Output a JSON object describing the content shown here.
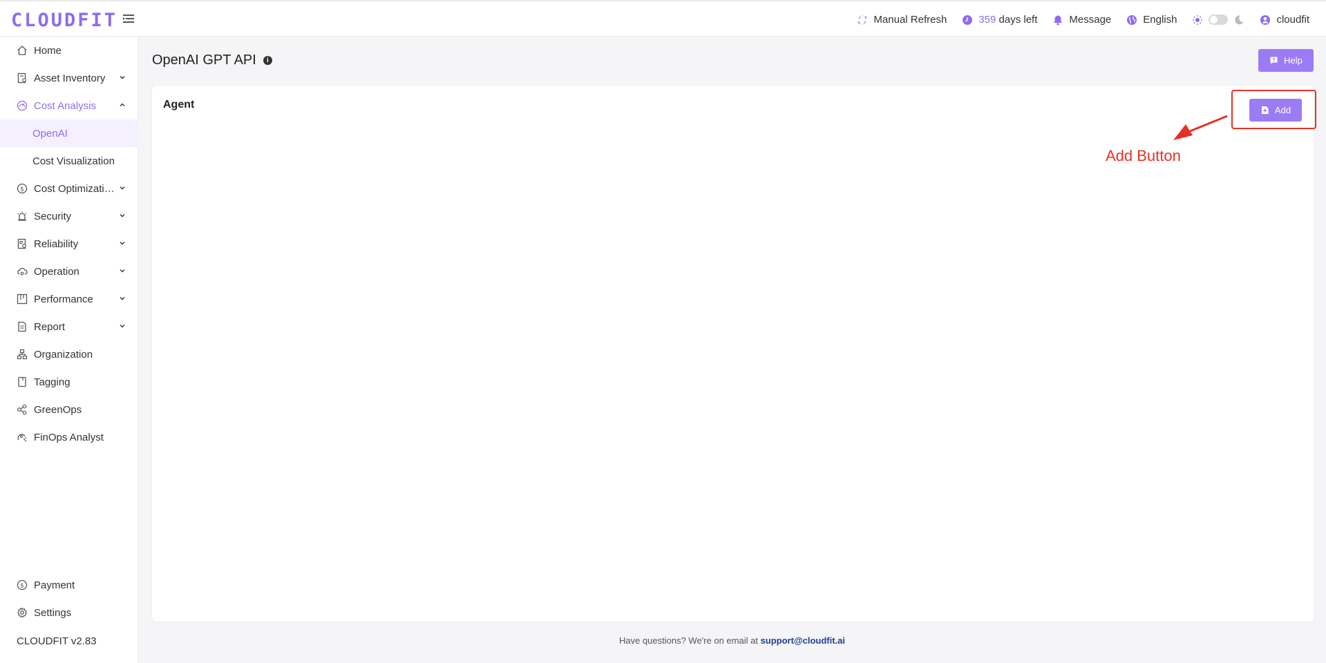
{
  "header": {
    "logo": "CLOUDFIT",
    "manual_refresh": "Manual Refresh",
    "days_count": "359",
    "days_suffix": "days left",
    "message": "Message",
    "language": "English",
    "user": "cloudfit"
  },
  "sidebar": {
    "items": [
      {
        "label": "Home"
      },
      {
        "label": "Asset Inventory"
      },
      {
        "label": "Cost Analysis"
      },
      {
        "label": "Cost Optimization"
      },
      {
        "label": "Security"
      },
      {
        "label": "Reliability"
      },
      {
        "label": "Operation"
      },
      {
        "label": "Performance"
      },
      {
        "label": "Report"
      },
      {
        "label": "Organization"
      },
      {
        "label": "Tagging"
      },
      {
        "label": "GreenOps"
      },
      {
        "label": "FinOps Analyst"
      }
    ],
    "sub_items": [
      {
        "label": "OpenAI"
      },
      {
        "label": "Cost Visualization"
      }
    ],
    "bottom": [
      {
        "label": "Payment"
      },
      {
        "label": "Settings"
      }
    ],
    "version": "CLOUDFIT v2.83"
  },
  "main": {
    "title": "OpenAI GPT API",
    "help_label": "Help",
    "card_title": "Agent",
    "add_label": "Add"
  },
  "annotation": {
    "text": "Add Button"
  },
  "footer": {
    "text": "Have questions? We're on email at",
    "email": "support@cloudfit.ai"
  },
  "colors": {
    "accent": "#8e6cf0",
    "button": "#9b7cf5",
    "annotation": "#e53125"
  }
}
